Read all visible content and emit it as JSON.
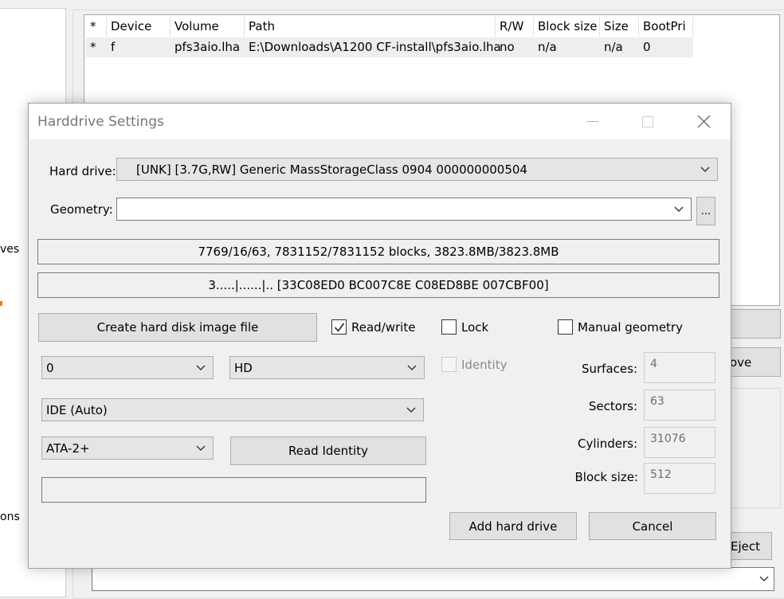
{
  "background": {
    "left_partial_labels": [
      "ves",
      "ons"
    ],
    "table": {
      "columns": [
        "*",
        "Device",
        "Volume",
        "Path",
        "R/W",
        "Block size",
        "Size",
        "BootPri"
      ],
      "rows": [
        [
          "*",
          "f",
          "pfs3aio.lha",
          "E:\\Downloads\\A1200 CF-install\\pfs3aio.lha",
          "no",
          "n/a",
          "n/a",
          "0"
        ]
      ]
    },
    "partial_buttons": {
      "remove": "ove",
      "eject": "Eject"
    }
  },
  "dialog": {
    "title": "Harddrive Settings",
    "hard_drive": {
      "label": "Hard drive:",
      "value": "[UNK] [3.7G,RW] Generic MassStorageClass 0904 000000000504"
    },
    "geometry": {
      "label": "Geometry:",
      "value": "",
      "browse_label": "..."
    },
    "info_line_1": "7769/16/63, 7831152/7831152 blocks, 3823.8MB/3823.8MB",
    "info_line_2": "3.....|......|.. [33C08ED0 BC007C8E C08ED8BE 007CBF00]",
    "create_image_button": "Create hard disk image file",
    "read_write": {
      "label": "Read/write",
      "checked": true
    },
    "lock": {
      "label": "Lock",
      "checked": false
    },
    "manual_geometry": {
      "label": "Manual geometry",
      "checked": false
    },
    "identity": {
      "label": "Identity",
      "checked": false,
      "enabled": false
    },
    "unit_select": "0",
    "type_select": "HD",
    "controller_select": "IDE (Auto)",
    "ata_select": "ATA-2+",
    "read_identity_button": "Read Identity",
    "identity_text": "",
    "surfaces": {
      "label": "Surfaces:",
      "value": "4"
    },
    "sectors": {
      "label": "Sectors:",
      "value": "63"
    },
    "cylinders": {
      "label": "Cylinders:",
      "value": "31076"
    },
    "block_size": {
      "label": "Block size:",
      "value": "512"
    },
    "add_button": "Add hard drive",
    "cancel_button": "Cancel"
  }
}
